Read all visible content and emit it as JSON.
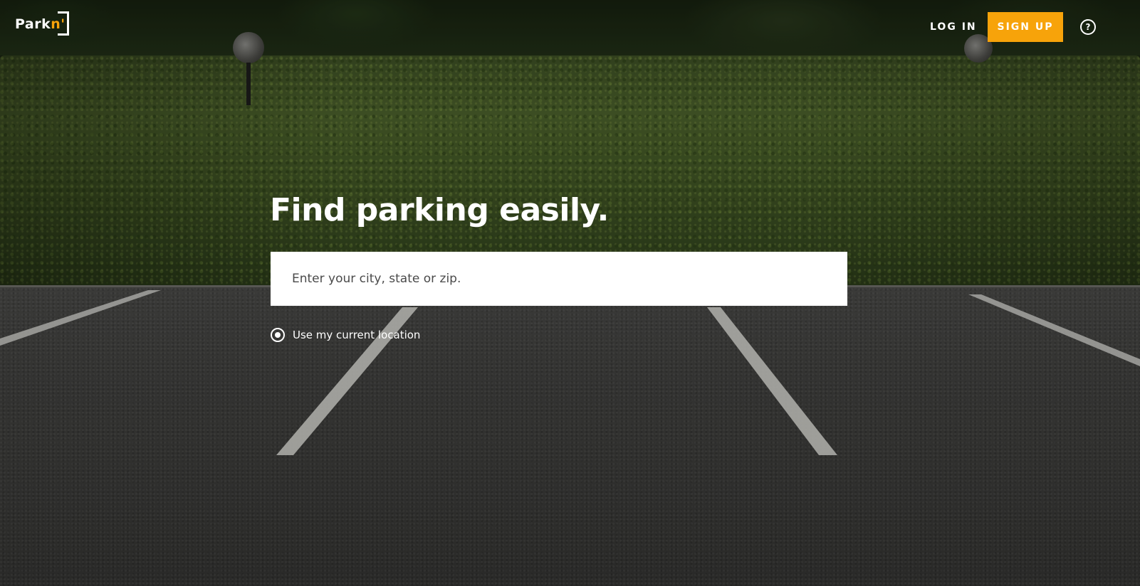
{
  "brand": {
    "name_main": "Park",
    "name_accent": "n'",
    "accent_color": "#f7a30a"
  },
  "nav": {
    "login_label": "LOG IN",
    "signup_label": "SIGN UP",
    "help_icon": "help-circle-icon",
    "help_glyph": "?"
  },
  "hero": {
    "title": "Find parking easily.",
    "search_placeholder": "Enter your city, state or zip.",
    "location_option_label": "Use my current location",
    "location_option_selected": true
  },
  "colors": {
    "signup_button": "#f7a30a",
    "text": "#ffffff",
    "search_background": "#ffffff"
  }
}
